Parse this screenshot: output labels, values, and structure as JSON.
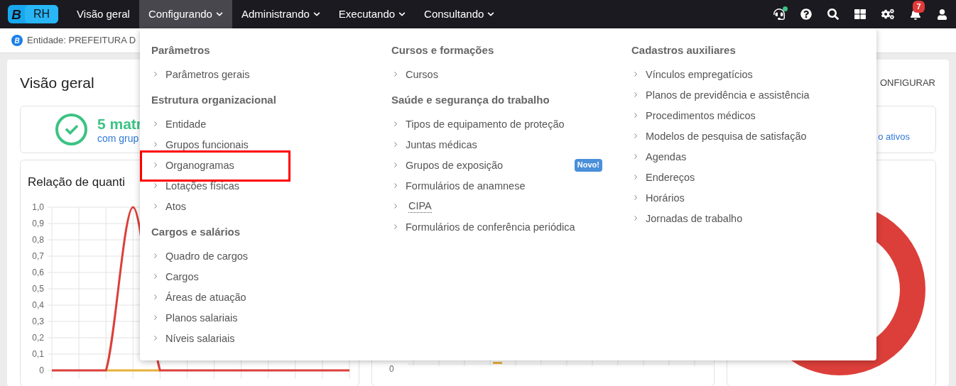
{
  "logo": {
    "letter": "B",
    "text": "RH"
  },
  "nav": [
    {
      "label": "Visão geral",
      "selected": false,
      "dropdown": false
    },
    {
      "label": "Configurando",
      "selected": true,
      "dropdown": true
    },
    {
      "label": "Administrando",
      "selected": false,
      "dropdown": true
    },
    {
      "label": "Executando",
      "selected": false,
      "dropdown": true
    },
    {
      "label": "Consultando",
      "selected": false,
      "dropdown": true
    }
  ],
  "notifications": {
    "count": "7"
  },
  "entity_bar": {
    "badge": "B",
    "text": "Entidade: PREFEITURA D"
  },
  "overview": {
    "title": "Visão geral",
    "action": "ONFIGURAR",
    "summary": {
      "value": "5 matr",
      "caption": "com grup",
      "right_link": "o ativos"
    },
    "line_chart": {
      "title": "Relação de quanti",
      "chart_data": {
        "type": "line",
        "grid": true,
        "ylim": [
          0,
          1
        ],
        "yticks": [
          {
            "value": 0,
            "label": "0"
          },
          {
            "value": 0.1,
            "label": "0,1"
          },
          {
            "value": 0.2,
            "label": "0,2"
          },
          {
            "value": 0.3,
            "label": "0,3"
          },
          {
            "value": 0.4,
            "label": "0,4"
          },
          {
            "value": 0.5,
            "label": "0,5"
          },
          {
            "value": 0.6,
            "label": "0,6"
          },
          {
            "value": 0.7,
            "label": "0,7"
          },
          {
            "value": 0.8,
            "label": "0,8"
          },
          {
            "value": 0.9,
            "label": "0,9"
          },
          {
            "value": 1,
            "label": "1,0"
          }
        ],
        "series": [
          {
            "color": "#e8b03a",
            "values": [
              null,
              null,
              0,
              0,
              0,
              null,
              null,
              null,
              null,
              null,
              null,
              null
            ]
          },
          {
            "color": "#dc3f3a",
            "values": [
              0,
              0,
              0,
              1,
              0,
              0,
              0,
              0,
              0,
              0,
              0,
              0
            ]
          }
        ]
      }
    },
    "bar_chart": {
      "ytick": "0"
    }
  },
  "menu": {
    "columns": [
      {
        "sections": [
          {
            "heading": "Parâmetros",
            "items": [
              {
                "label": "Parâmetros gerais",
                "highlighted": false
              }
            ]
          },
          {
            "heading": "Estrutura organizacional",
            "items": [
              {
                "label": "Entidade",
                "highlighted": false
              },
              {
                "label": "Grupos funcionais",
                "highlighted": false
              },
              {
                "label": "Organogramas",
                "highlighted": true
              },
              {
                "label": "Lotações físicas",
                "highlighted": false
              },
              {
                "label": "Atos",
                "highlighted": false
              }
            ]
          },
          {
            "heading": "Cargos e salários",
            "items": [
              {
                "label": "Quadro de cargos",
                "highlighted": false
              },
              {
                "label": "Cargos",
                "highlighted": false
              },
              {
                "label": "Áreas de atuação",
                "highlighted": false
              },
              {
                "label": "Planos salariais",
                "highlighted": false
              },
              {
                "label": "Níveis salariais",
                "highlighted": false
              }
            ]
          }
        ]
      },
      {
        "sections": [
          {
            "heading": "Cursos e formações",
            "items": [
              {
                "label": "Cursos",
                "highlighted": false
              }
            ]
          },
          {
            "heading": "Saúde e segurança do trabalho",
            "items": [
              {
                "label": "Tipos de equipamento de proteção",
                "highlighted": false
              },
              {
                "label": "Juntas médicas",
                "highlighted": false
              },
              {
                "label": "Grupos de exposição",
                "highlighted": false,
                "badge": "Novo!"
              },
              {
                "label": "Formulários de anamnese",
                "highlighted": false
              },
              {
                "label": "CIPA",
                "highlighted": false,
                "abbr": true
              },
              {
                "label": "Formulários de conferência periódica",
                "highlighted": false
              }
            ]
          }
        ]
      },
      {
        "sections": [
          {
            "heading": "Cadastros auxiliares",
            "items": [
              {
                "label": "Vínculos empregatícios",
                "highlighted": false
              },
              {
                "label": "Planos de previdência e assistência",
                "highlighted": false
              },
              {
                "label": "Procedimentos médicos",
                "highlighted": false
              },
              {
                "label": "Modelos de pesquisa de satisfação",
                "highlighted": false
              },
              {
                "label": "Agendas",
                "highlighted": false
              },
              {
                "label": "Endereços",
                "highlighted": false
              },
              {
                "label": "Horários",
                "highlighted": false
              },
              {
                "label": "Jornadas de trabalho",
                "highlighted": false
              }
            ]
          }
        ]
      }
    ]
  }
}
